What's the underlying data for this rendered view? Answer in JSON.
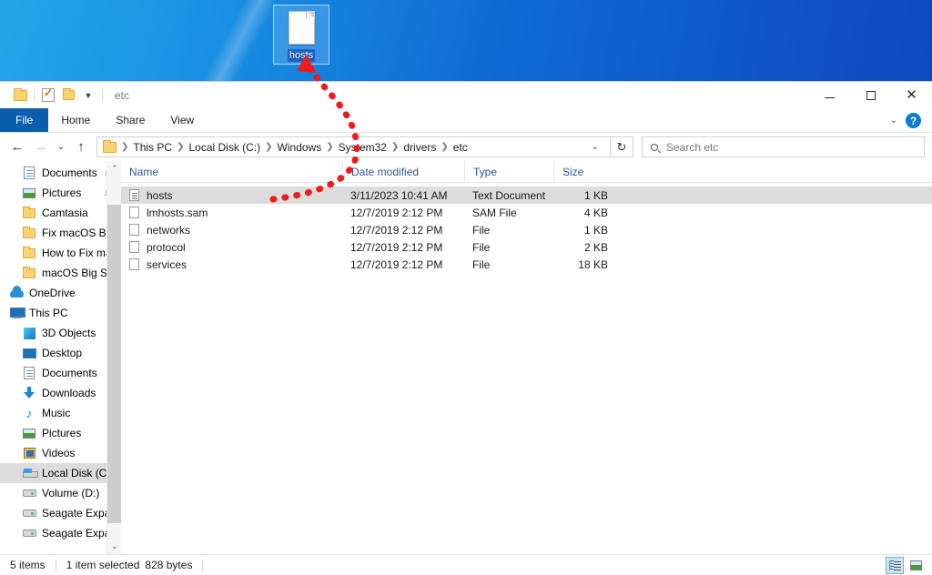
{
  "desktop": {
    "icon": {
      "label": "hosts",
      "icon": "text-file-icon",
      "selected": true
    }
  },
  "window": {
    "title": "etc",
    "quick_access": [
      {
        "name": "folder-icon",
        "label": ""
      },
      {
        "name": "properties-icon",
        "label": ""
      },
      {
        "name": "new-folder-icon",
        "label": ""
      },
      {
        "name": "customize-caret-icon",
        "label": "▾"
      }
    ],
    "controls": {
      "minimize": "minimize-icon",
      "maximize": "maximize-icon",
      "close": "close-icon"
    },
    "ribbon": {
      "tabs": [
        {
          "label": "File",
          "active": true
        },
        {
          "label": "Home",
          "active": false
        },
        {
          "label": "Share",
          "active": false
        },
        {
          "label": "View",
          "active": false
        }
      ],
      "collapse_caret": "⌄",
      "help_label": "?"
    },
    "address": {
      "back": "←",
      "forward": "→",
      "recent": "⌄",
      "up": "↑",
      "crumbs": [
        "This PC",
        "Local Disk (C:)",
        "Windows",
        "System32",
        "drivers",
        "etc"
      ],
      "crumb_caret": "⌄",
      "refresh": "↻"
    },
    "search": {
      "placeholder": "Search etc",
      "value": "",
      "icon": "search-icon"
    }
  },
  "sidebar": {
    "items": [
      {
        "label": "Documents",
        "icon": "documents-icon",
        "indent": 1,
        "pinned": true,
        "selected": false
      },
      {
        "label": "Pictures",
        "icon": "pictures-icon",
        "indent": 1,
        "pinned": true,
        "selected": false
      },
      {
        "label": "Camtasia",
        "icon": "folder-icon",
        "indent": 1,
        "pinned": false,
        "selected": false
      },
      {
        "label": "Fix macOS Big S",
        "icon": "folder-icon",
        "indent": 1,
        "pinned": false,
        "selected": false
      },
      {
        "label": "How to Fix macO",
        "icon": "folder-icon",
        "indent": 1,
        "pinned": false,
        "selected": false
      },
      {
        "label": "macOS Big Sur IS",
        "icon": "folder-icon",
        "indent": 1,
        "pinned": false,
        "selected": false
      },
      {
        "label": "OneDrive",
        "icon": "onedrive-icon",
        "indent": 0,
        "pinned": false,
        "selected": false
      },
      {
        "label": "This PC",
        "icon": "this-pc-icon",
        "indent": 0,
        "pinned": false,
        "selected": false
      },
      {
        "label": "3D Objects",
        "icon": "3d-objects-icon",
        "indent": 1,
        "pinned": false,
        "selected": false
      },
      {
        "label": "Desktop",
        "icon": "desktop-icon",
        "indent": 1,
        "pinned": false,
        "selected": false
      },
      {
        "label": "Documents",
        "icon": "documents-icon",
        "indent": 1,
        "pinned": false,
        "selected": false
      },
      {
        "label": "Downloads",
        "icon": "downloads-icon",
        "indent": 1,
        "pinned": false,
        "selected": false
      },
      {
        "label": "Music",
        "icon": "music-icon",
        "indent": 1,
        "pinned": false,
        "selected": false
      },
      {
        "label": "Pictures",
        "icon": "pictures-icon",
        "indent": 1,
        "pinned": false,
        "selected": false
      },
      {
        "label": "Videos",
        "icon": "videos-icon",
        "indent": 1,
        "pinned": false,
        "selected": false
      },
      {
        "label": "Local Disk (C:)",
        "icon": "disk-icon",
        "indent": 1,
        "pinned": false,
        "selected": true
      },
      {
        "label": "Volume (D:)",
        "icon": "drive-icon",
        "indent": 1,
        "pinned": false,
        "selected": false
      },
      {
        "label": "Seagate Expansi",
        "icon": "drive-icon",
        "indent": 1,
        "pinned": false,
        "selected": false
      },
      {
        "label": "Seagate Expansion",
        "icon": "drive-icon",
        "indent": 1,
        "pinned": false,
        "selected": false
      }
    ]
  },
  "file_list": {
    "columns": [
      {
        "label": "Name",
        "sorted": "asc"
      },
      {
        "label": "Date modified",
        "sorted": ""
      },
      {
        "label": "Type",
        "sorted": ""
      },
      {
        "label": "Size",
        "sorted": ""
      }
    ],
    "sort_caret": "⌃",
    "rows": [
      {
        "name": "hosts",
        "date": "3/11/2023 10:41 AM",
        "type": "Text Document",
        "size": "1 KB",
        "icon": "text-file-icon",
        "selected": true
      },
      {
        "name": "lmhosts.sam",
        "date": "12/7/2019 2:12 PM",
        "type": "SAM File",
        "size": "4 KB",
        "icon": "file-icon",
        "selected": false
      },
      {
        "name": "networks",
        "date": "12/7/2019 2:12 PM",
        "type": "File",
        "size": "1 KB",
        "icon": "file-icon",
        "selected": false
      },
      {
        "name": "protocol",
        "date": "12/7/2019 2:12 PM",
        "type": "File",
        "size": "2 KB",
        "icon": "file-icon",
        "selected": false
      },
      {
        "name": "services",
        "date": "12/7/2019 2:12 PM",
        "type": "File",
        "size": "18 KB",
        "icon": "file-icon",
        "selected": false
      }
    ]
  },
  "status": {
    "item_count": "5 items",
    "selection": "1 item selected",
    "size": "828 bytes",
    "views": [
      {
        "name": "details-view-button",
        "active": true
      },
      {
        "name": "large-icons-view-button",
        "active": false
      }
    ]
  },
  "annotation": {
    "arrow_color": "#ee1c1c",
    "description": "dotted-arrow-drag-hosts-to-desktop"
  }
}
